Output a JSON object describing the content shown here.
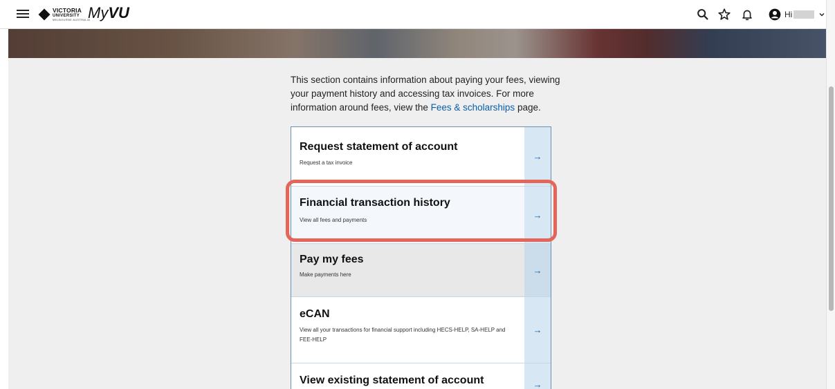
{
  "header": {
    "logo_line1": "VICTORIA",
    "logo_line2": "UNIVERSITY",
    "logo_line3": "MELBOURNE AUSTRALIA",
    "brand_light": "My",
    "brand_bold": "VU",
    "greeting": "Hi",
    "icons": [
      "menu-icon",
      "search-icon",
      "star-icon",
      "bell-icon",
      "user-circle-icon",
      "chevron-down-icon"
    ]
  },
  "intro": {
    "text_before": "This section contains information about paying your fees, viewing your payment history and accessing tax invoices. For more information around fees, view the ",
    "link": "Fees & scholarships",
    "text_after": " page."
  },
  "cards": [
    {
      "title": "Request statement of account",
      "desc": "Request a tax invoice"
    },
    {
      "title": "Financial transaction history",
      "desc": "View all fees and payments"
    },
    {
      "title": "Pay my fees",
      "desc": "Make payments here"
    },
    {
      "title": "eCAN",
      "desc": "View all your transactions for financial support including HECS-HELP, SA-HELP and FEE-HELP"
    },
    {
      "title": "View existing statement of account",
      "desc": ""
    }
  ],
  "arrow_glyph": "→",
  "colors": {
    "link": "#0a5ea8",
    "highlight": "#e4655a",
    "arrow_panel": "#d7e7f4",
    "content_bg": "#efefef"
  }
}
